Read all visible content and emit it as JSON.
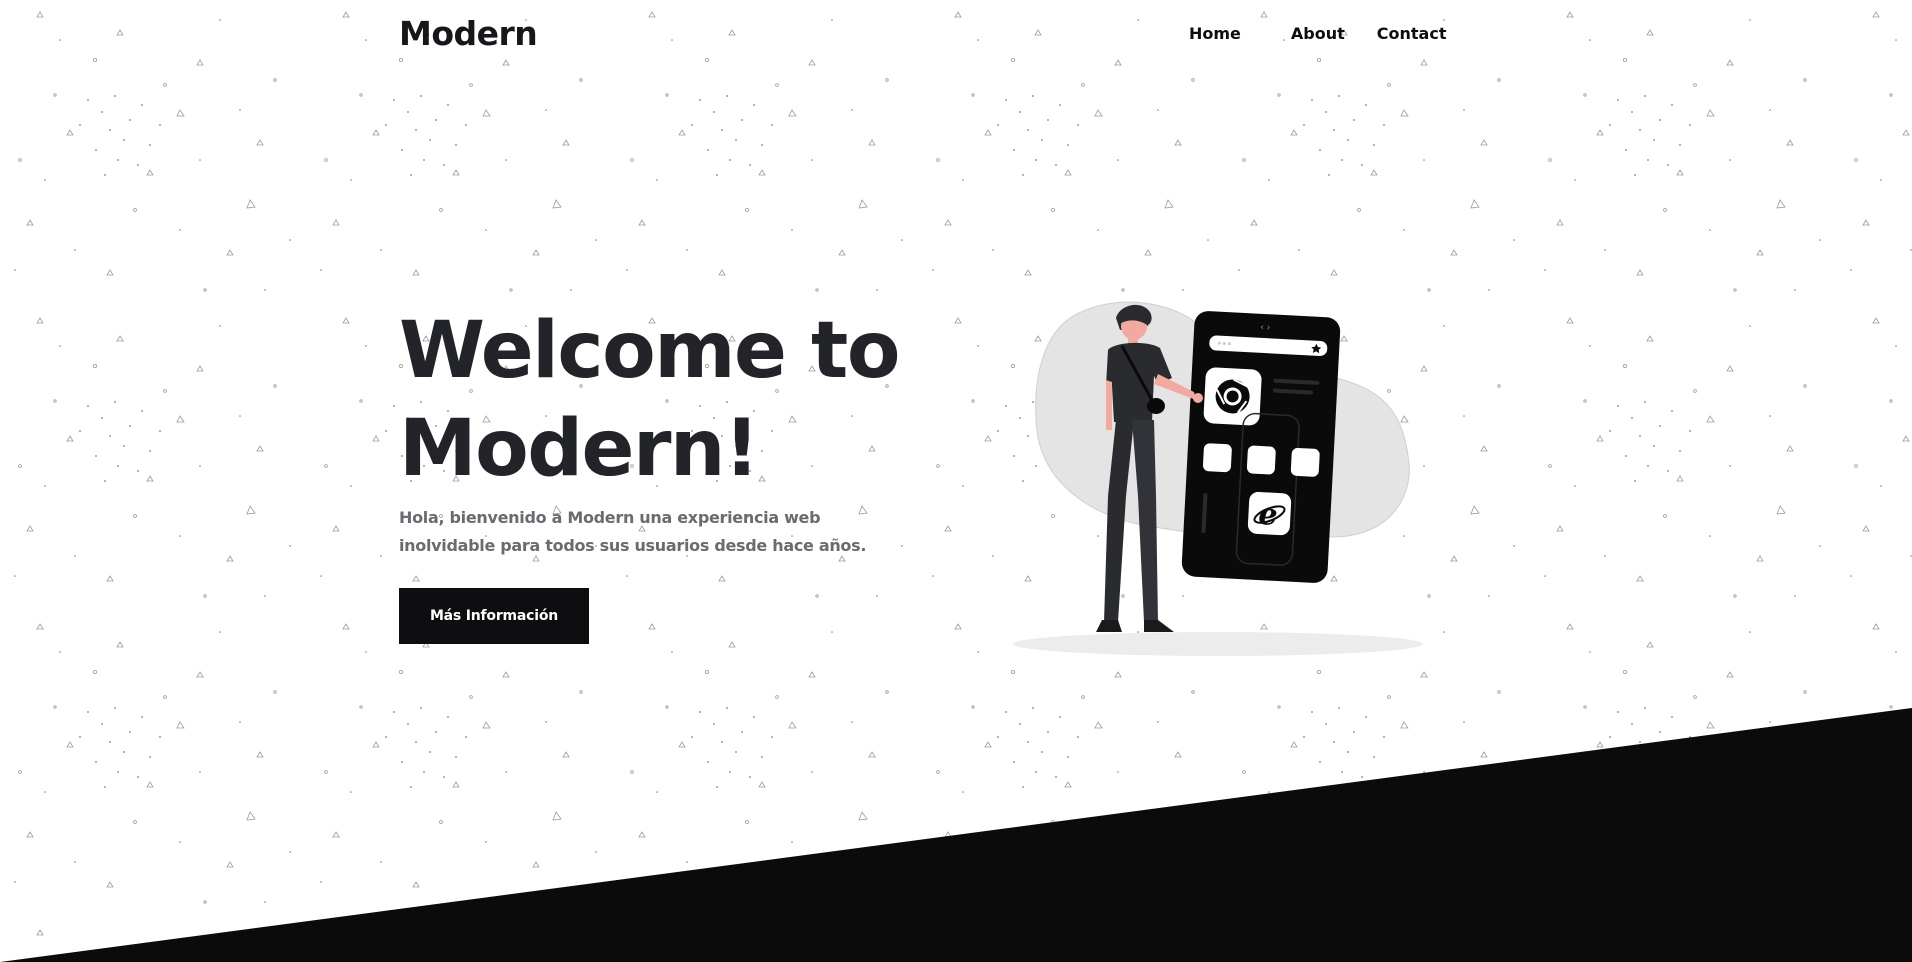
{
  "brand": {
    "name": "Modern"
  },
  "nav": {
    "items": [
      "Home",
      "About",
      "Contact"
    ]
  },
  "hero": {
    "title_line1": "Welcome to",
    "title_line2": "Modern!",
    "subtitle_line1": "Hola, bienvenido a Modern una experiencia web",
    "subtitle_line2": "inolvidable para todos sus usuarios desde hace años.",
    "cta_label": "Más Información"
  },
  "illustration": {
    "icons": [
      "chrome-icon",
      "internet-explorer-icon",
      "star-icon"
    ]
  },
  "colors": {
    "background": "#ffffff",
    "text": "#23242a",
    "subtext": "#6a6b70",
    "button": "#0e0e10",
    "phone": "#0a0a0a",
    "blob": "#e4e4e4",
    "footer_band": "#0b0b0b"
  }
}
